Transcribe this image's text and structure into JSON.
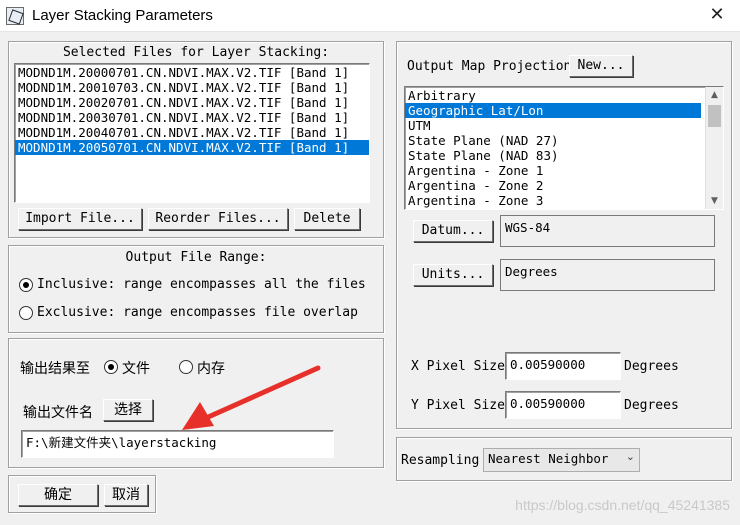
{
  "window": {
    "title": "Layer Stacking Parameters",
    "app_icon": "layer-stack-icon",
    "close_icon": "close-icon"
  },
  "selected_files": {
    "title": "Selected Files for Layer Stacking:",
    "items": [
      {
        "label": "MODND1M.20000701.CN.NDVI.MAX.V2.TIF [Band 1]",
        "selected": false
      },
      {
        "label": "MODND1M.20010703.CN.NDVI.MAX.V2.TIF [Band 1]",
        "selected": false
      },
      {
        "label": "MODND1M.20020701.CN.NDVI.MAX.V2.TIF [Band 1]",
        "selected": false
      },
      {
        "label": "MODND1M.20030701.CN.NDVI.MAX.V2.TIF [Band 1]",
        "selected": false
      },
      {
        "label": "MODND1M.20040701.CN.NDVI.MAX.V2.TIF [Band 1]",
        "selected": false
      },
      {
        "label": "MODND1M.20050701.CN.NDVI.MAX.V2.TIF [Band 1]",
        "selected": true
      }
    ],
    "buttons": {
      "import": "Import File...",
      "reorder": "Reorder Files...",
      "delete": "Delete"
    }
  },
  "output_range": {
    "title": "Output File Range:",
    "inclusive": "Inclusive: range encompasses all the files",
    "exclusive": "Exclusive: range encompasses file overlap",
    "selected": "inclusive"
  },
  "output": {
    "to_label": "输出结果至",
    "file_option": "文件",
    "memory_option": "内存",
    "selected": "file",
    "filename_label": "输出文件名",
    "choose_button": "选择",
    "filename_value": "F:\\新建文件夹\\layerstacking"
  },
  "dialog_buttons": {
    "ok": "确定",
    "cancel": "取消"
  },
  "projection": {
    "label": "Output Map Projection",
    "new_button": "New...",
    "items": [
      {
        "label": "Arbitrary",
        "selected": false
      },
      {
        "label": "Geographic Lat/Lon",
        "selected": true
      },
      {
        "label": "UTM",
        "selected": false
      },
      {
        "label": "State Plane (NAD 27)",
        "selected": false
      },
      {
        "label": "State Plane (NAD 83)",
        "selected": false
      },
      {
        "label": "Argentina - Zone 1",
        "selected": false
      },
      {
        "label": "Argentina - Zone 2",
        "selected": false
      },
      {
        "label": "Argentina - Zone 3",
        "selected": false
      }
    ],
    "datum_button": "Datum...",
    "datum_value": "WGS-84",
    "units_button": "Units...",
    "units_value": "Degrees"
  },
  "pixel_size": {
    "x_label": "X Pixel Size",
    "x_value": "0.00590000",
    "x_unit": "Degrees",
    "y_label": "Y Pixel Size",
    "y_value": "0.00590000",
    "y_unit": "Degrees"
  },
  "resampling": {
    "label": "Resampling",
    "value": "Nearest Neighbor"
  },
  "annotation": {
    "arrow_color": "#e8302a"
  },
  "watermark": "https://blog.csdn.net/qq_45241385",
  "colors": {
    "selection": "#0078d7",
    "background": "#f0f0f0"
  }
}
